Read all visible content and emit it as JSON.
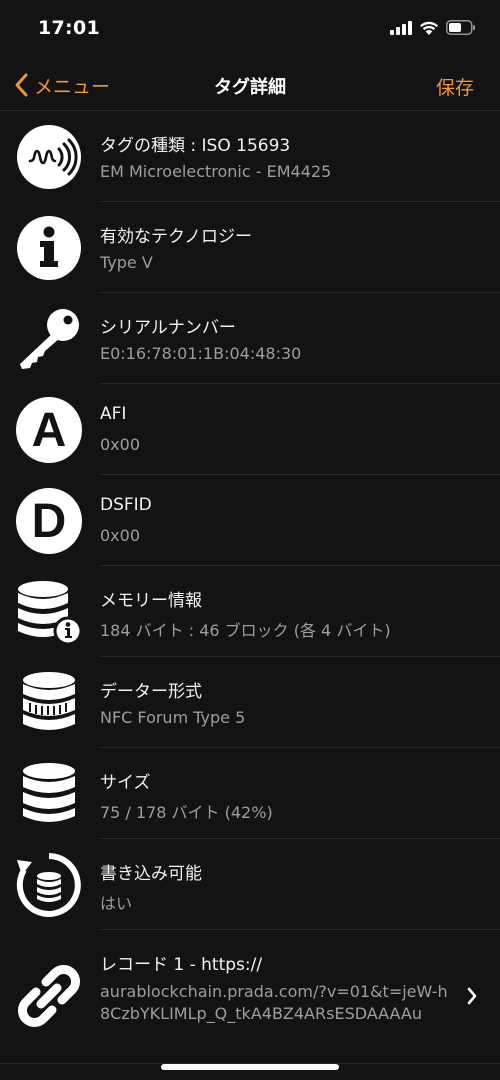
{
  "status": {
    "time": "17:01"
  },
  "nav": {
    "back_label": "メニュー",
    "title": "タグ詳細",
    "save_label": "保存"
  },
  "rows": [
    {
      "icon": "nfc-signal-icon",
      "title": "タグの種類 : ISO 15693",
      "value": "EM Microelectronic - EM4425"
    },
    {
      "icon": "info-icon",
      "title": "有効なテクノロジー",
      "value": "Type V"
    },
    {
      "icon": "key-icon",
      "title": "シリアルナンバー",
      "value": "E0:16:78:01:1B:04:48:30"
    },
    {
      "icon": "letter-a-icon",
      "title": "AFI",
      "value": "0x00",
      "letter": "A"
    },
    {
      "icon": "letter-d-icon",
      "title": "DSFID",
      "value": "0x00",
      "letter": "D"
    },
    {
      "icon": "database-info-icon",
      "title": "メモリー情報",
      "value": "184 バイト : 46 ブロック (各 4 バイト)"
    },
    {
      "icon": "database-format-icon",
      "title": "データー形式",
      "value": "NFC Forum Type 5"
    },
    {
      "icon": "database-icon",
      "title": "サイズ",
      "value": "75 / 178 バイト (42%)"
    },
    {
      "icon": "database-refresh-icon",
      "title": "書き込み可能",
      "value": "はい"
    },
    {
      "icon": "link-icon",
      "title": "レコード 1 - https://",
      "value": "aurablockchain.prada.com/?v=01&t=jeW-h8CzbYKLIMLp_Q_tkA4BZ4ARsESDAAAAu"
    }
  ],
  "colors": {
    "accent": "#f0953a",
    "background": "#131313",
    "secondary_text": "#9d9da2"
  }
}
